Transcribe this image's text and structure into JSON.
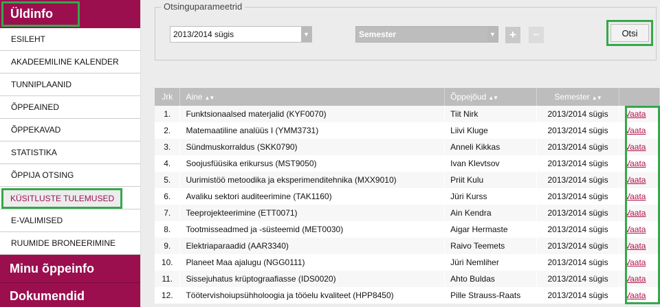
{
  "sidebar": {
    "section1": "Üldinfo",
    "items": [
      {
        "label": "ESILEHT",
        "active": false
      },
      {
        "label": "AKADEEMILINE KALENDER",
        "active": false
      },
      {
        "label": "TUNNIPLAANID",
        "active": false
      },
      {
        "label": "ÕPPEAINED",
        "active": false
      },
      {
        "label": "ÕPPEKAVAD",
        "active": false
      },
      {
        "label": "STATISTIKA",
        "active": false
      },
      {
        "label": "ÕPPIJA OTSING",
        "active": false
      },
      {
        "label": "KÜSITLUSTE TULEMUSED",
        "active": true
      },
      {
        "label": "E-VALIMISED",
        "active": false
      },
      {
        "label": "RUUMIDE BRONEERIMINE",
        "active": false
      }
    ],
    "section2": "Minu õppeinfo",
    "section3": "Dokumendid"
  },
  "search": {
    "legend": "Otsinguparameetrid",
    "period_value": "2013/2014 sügis",
    "semester_value": "Semester",
    "add_label": "+",
    "remove_label": "−",
    "submit_label": "Otsi"
  },
  "table": {
    "headers": {
      "idx": "Jrk",
      "course": "Aine",
      "teacher": "Õppejõud",
      "semester": "Semester"
    },
    "sort_glyph": "▲▼",
    "action_label": "Vaata",
    "rows": [
      {
        "idx": "1.",
        "course": "Funktsionaalsed materjalid (KYF0070)",
        "teacher": "Tiit Nirk",
        "semester": "2013/2014 sügis"
      },
      {
        "idx": "2.",
        "course": "Matemaatiline analüüs I (YMM3731)",
        "teacher": "Liivi Kluge",
        "semester": "2013/2014 sügis"
      },
      {
        "idx": "3.",
        "course": "Sündmuskorraldus (SKK0790)",
        "teacher": "Anneli Kikkas",
        "semester": "2013/2014 sügis"
      },
      {
        "idx": "4.",
        "course": "Soojusfüüsika erikursus (MST9050)",
        "teacher": "Ivan Klevtsov",
        "semester": "2013/2014 sügis"
      },
      {
        "idx": "5.",
        "course": "Uurimistöö metoodika ja eksperimenditehnika (MXX9010)",
        "teacher": "Priit Kulu",
        "semester": "2013/2014 sügis"
      },
      {
        "idx": "6.",
        "course": "Avaliku sektori auditeerimine (TAK1160)",
        "teacher": "Jüri Kurss",
        "semester": "2013/2014 sügis"
      },
      {
        "idx": "7.",
        "course": "Teeprojekteerimine (ETT0071)",
        "teacher": "Ain Kendra",
        "semester": "2013/2014 sügis"
      },
      {
        "idx": "8.",
        "course": "Tootmisseadmed ja -süsteemid (MET0030)",
        "teacher": "Aigar Hermaste",
        "semester": "2013/2014 sügis"
      },
      {
        "idx": "9.",
        "course": "Elektriaparaadid (AAR3340)",
        "teacher": "Raivo Teemets",
        "semester": "2013/2014 sügis"
      },
      {
        "idx": "10.",
        "course": "Planeet Maa ajalugu (NGG0111)",
        "teacher": "Jüri Nemliher",
        "semester": "2013/2014 sügis"
      },
      {
        "idx": "11.",
        "course": "Sissejuhatus krüptograafiasse (IDS0020)",
        "teacher": "Ahto Buldas",
        "semester": "2013/2014 sügis"
      },
      {
        "idx": "12.",
        "course": "Töötervishoiupsühholoogia ja tööelu kvaliteet (HPP8450)",
        "teacher": "Pille Strauss-Raats",
        "semester": "2013/2014 sügis"
      }
    ]
  }
}
